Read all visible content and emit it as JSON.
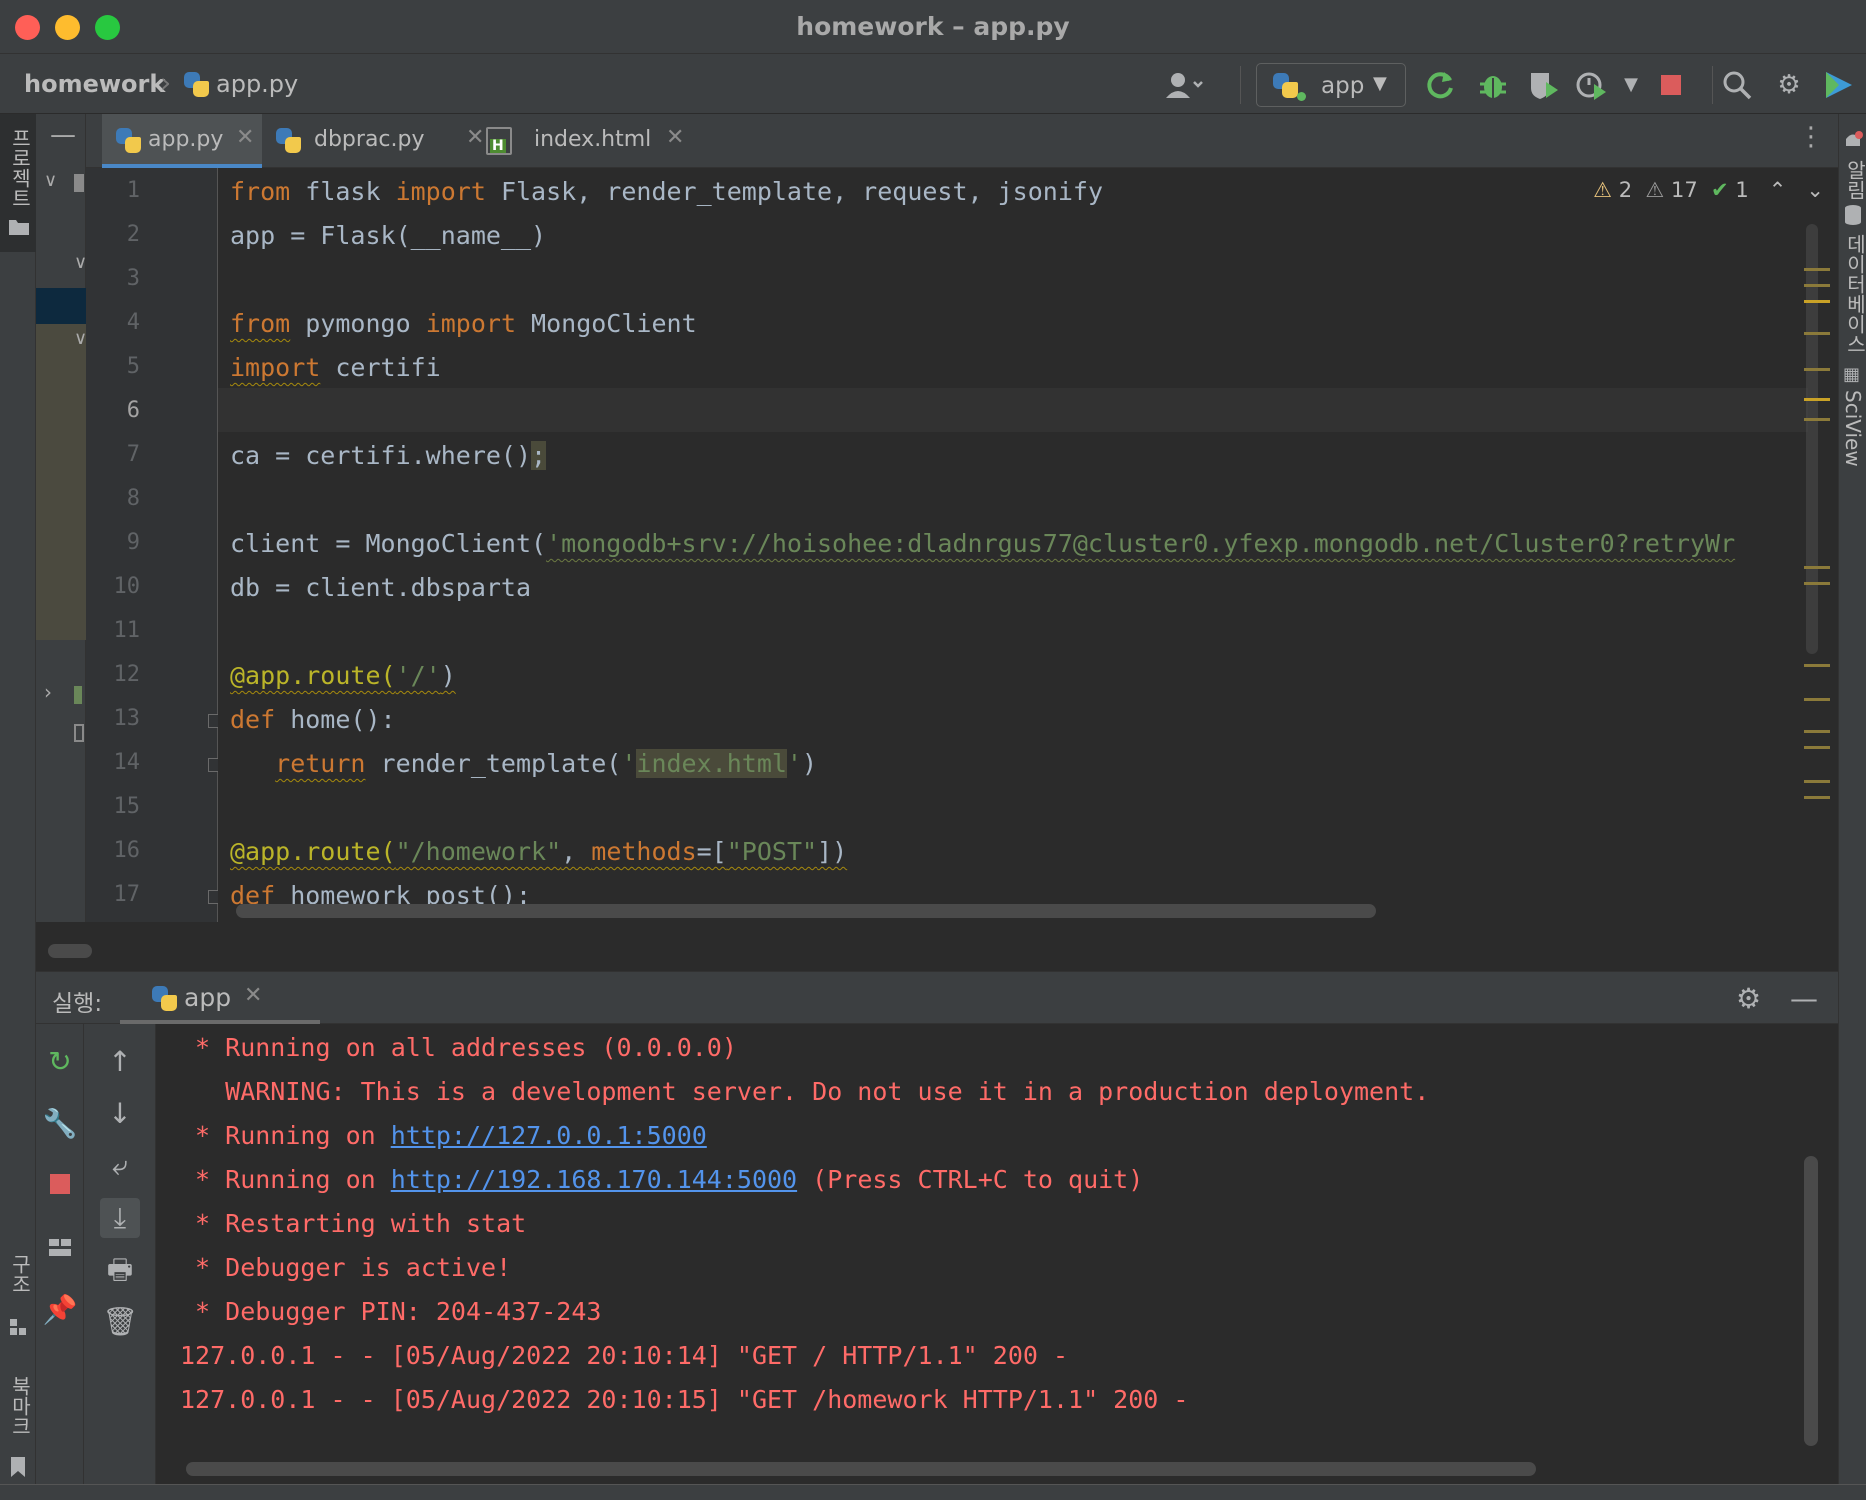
{
  "window": {
    "title": "homework – app.py"
  },
  "breadcrumb": {
    "project": "homework",
    "file": "app.py"
  },
  "toolbar": {
    "run_config": "app",
    "icons": [
      "user-icon",
      "rerun-icon",
      "debug-icon",
      "coverage-icon",
      "profile-icon",
      "stop-icon",
      "search-icon",
      "gear-icon",
      "plugin-icon"
    ]
  },
  "left_strip": {
    "project_label": "프로젝트",
    "structure_label": "구조",
    "bookmarks_label": "북마크"
  },
  "right_strip": {
    "notifications_label": "알림",
    "database_label": "데이터베이스",
    "sciview_label": "SciView"
  },
  "tabs": [
    {
      "name": "app.py",
      "active": true,
      "icon": "python-file-icon"
    },
    {
      "name": "dbprac.py",
      "active": false,
      "icon": "python-file-icon"
    },
    {
      "name": "index.html",
      "active": false,
      "icon": "html-file-icon"
    }
  ],
  "inspections": {
    "warnings": "2",
    "weak_warnings": "17",
    "ok": "1"
  },
  "line_numbers": [
    "1",
    "2",
    "3",
    "4",
    "5",
    "6",
    "7",
    "8",
    "9",
    "10",
    "11",
    "12",
    "13",
    "14",
    "15",
    "16",
    "17"
  ],
  "code": {
    "l1": {
      "from": "from",
      "mod": " flask ",
      "imp": "import",
      "names": " Flask, render_template, request, jsonify"
    },
    "l2": "app = Flask(__name__)",
    "l4": {
      "from": "from",
      "mod": " pymongo ",
      "imp": "import",
      "names": " MongoClient"
    },
    "l5": {
      "imp": "import",
      "names": " certifi"
    },
    "l7": {
      "pre": "ca = certifi.where()",
      "semi": ";"
    },
    "l9": {
      "pre": "client = MongoClient(",
      "str": "'mongodb+srv://hoisohee:dladnrgus77@cluster0.yfexp.mongodb.net/Cluster0?retryWr"
    },
    "l10": "db = client.dbsparta",
    "l12": {
      "dec": "@app.route(",
      "str": "'/'",
      "close": ")"
    },
    "l13": {
      "def": "def",
      "rest": " home():"
    },
    "l14": {
      "ret": "return",
      "pre": " render_template(",
      "q1": "'",
      "hl": "index.html",
      "q2": "'",
      "close": ")"
    },
    "l16": {
      "dec": "@app.route(",
      "str": "\"/homework\"",
      "comma": ", ",
      "kw": "methods",
      "eq": "=[",
      "str2": "\"POST\"",
      "close": "])"
    },
    "l17": {
      "def": "def",
      "rest": " homework_post():"
    }
  },
  "run_panel": {
    "title": "실행:",
    "tab": "app",
    "lines": {
      "c1": " * Running on all addresses (0.0.0.0)",
      "c2": "   WARNING: This is a development server. Do not use it in a production deployment.",
      "c3_pre": " * Running on ",
      "c3_link": "http://127.0.0.1:5000",
      "c4_pre": " * Running on ",
      "c4_link": "http://192.168.170.144:5000",
      "c4_post": " (Press CTRL+C to quit)",
      "c5": " * Restarting with stat",
      "c6": " * Debugger is active!",
      "c7": " * Debugger PIN: 204-437-243",
      "c8": "127.0.0.1 - - [05/Aug/2022 20:10:14] \"GET / HTTP/1.1\" 200 -",
      "c9": "127.0.0.1 - - [05/Aug/2022 20:10:15] \"GET /homework HTTP/1.1\" 200 -"
    }
  },
  "colors": {
    "accent": "#4a88c7",
    "console_text": "#ff6b68",
    "link": "#5394ec",
    "keyword": "#cc7832",
    "string": "#6a8759"
  }
}
